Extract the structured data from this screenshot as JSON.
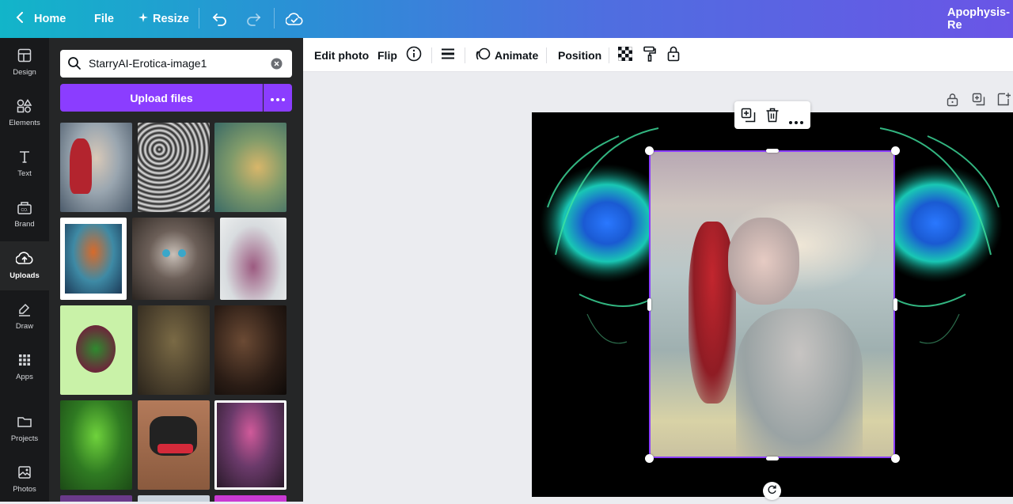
{
  "topbar": {
    "home_label": "Home",
    "file_label": "File",
    "resize_label": "Resize",
    "design_title": "Apophysis-Re"
  },
  "rail": [
    {
      "label": "Design",
      "icon": "layout-icon"
    },
    {
      "label": "Elements",
      "icon": "shapes-icon"
    },
    {
      "label": "Text",
      "icon": "text-icon"
    },
    {
      "label": "Brand",
      "icon": "brand-icon"
    },
    {
      "label": "Uploads",
      "icon": "cloud-upload-icon"
    },
    {
      "label": "Draw",
      "icon": "pen-icon"
    },
    {
      "label": "Apps",
      "icon": "grid-icon"
    },
    {
      "label": "Projects",
      "icon": "folder-icon"
    },
    {
      "label": "Photos",
      "icon": "image-icon"
    }
  ],
  "panel": {
    "search_value": "StarryAI-Erotica-image1",
    "upload_label": "Upload files"
  },
  "toolbar": {
    "edit_photo": "Edit photo",
    "flip": "Flip",
    "animate": "Animate",
    "position": "Position"
  },
  "colors": {
    "accent": "#8b3dff",
    "rail_bg": "#18191b",
    "panel_bg": "#252627"
  }
}
